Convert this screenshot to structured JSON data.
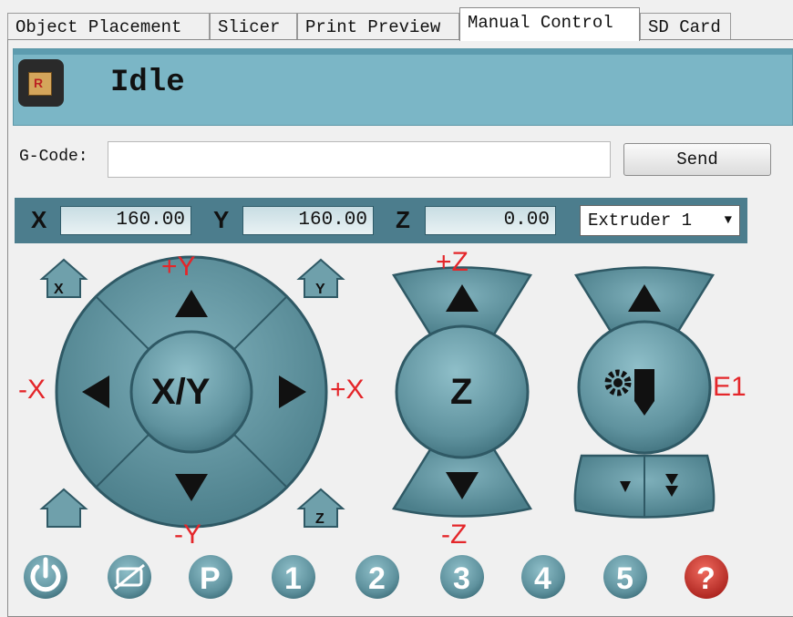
{
  "tabs": [
    "Object Placement",
    "Slicer",
    "Print Preview",
    "Manual Control",
    "SD Card"
  ],
  "status": {
    "text": "Idle",
    "logo_letter": "R"
  },
  "gcode": {
    "label": "G-Code:",
    "value": "",
    "send_label": "Send"
  },
  "position": {
    "x": {
      "label": "X",
      "value": "160.00"
    },
    "y": {
      "label": "Y",
      "value": "160.00"
    },
    "z": {
      "label": "Z",
      "value": "0.00"
    }
  },
  "extruder_select": {
    "selected": "Extruder 1"
  },
  "xy_pad": {
    "center": "X/Y",
    "plus_y": "+Y",
    "minus_y": "-Y",
    "plus_x": "+X",
    "minus_x": "-X"
  },
  "z_pad": {
    "center": "Z",
    "plus_z": "+Z",
    "minus_z": "-Z"
  },
  "extruder_pad": {
    "label": "E1"
  },
  "home_icons": [
    "home-x-icon",
    "home-y-icon",
    "home-all-icon",
    "home-z-icon"
  ],
  "bottom_buttons": [
    "power-icon",
    "fan-off-icon",
    "parking-icon",
    "1",
    "2",
    "3",
    "4",
    "5",
    "help-icon"
  ],
  "colors": {
    "teal": "#6e9faa",
    "teal_dark": "#33606d",
    "red_label": "#e4262a",
    "help_red": "#c9312c"
  }
}
